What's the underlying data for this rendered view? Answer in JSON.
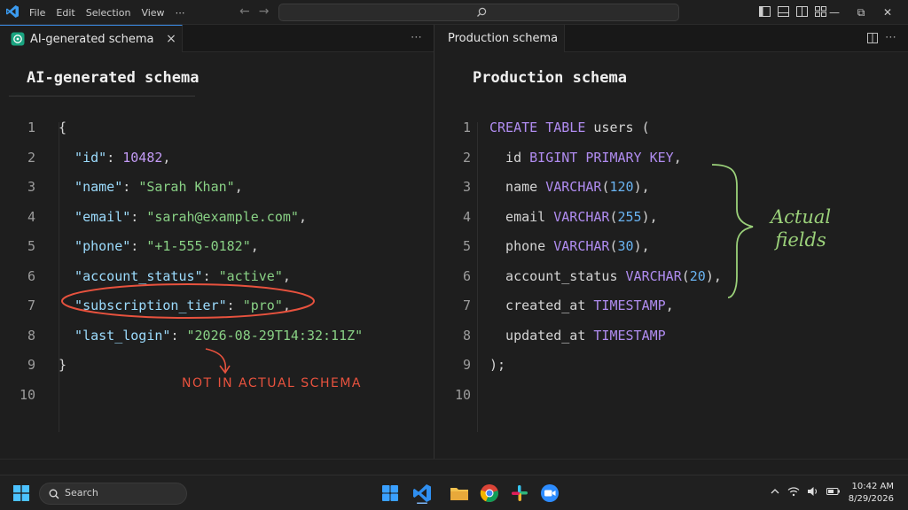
{
  "menu": [
    "File",
    "Edit",
    "Selection",
    "View",
    "⋯"
  ],
  "left": {
    "tab_label": "AI-generated schema",
    "close": "×",
    "more": "⋯",
    "heading": "AI-generated schema",
    "lines": [
      {
        "num": "1",
        "parts": [
          [
            "p",
            "{"
          ]
        ]
      },
      {
        "num": "2",
        "parts": [
          [
            "k",
            "  \"id\""
          ],
          [
            "p",
            ": "
          ],
          [
            "n",
            "10482"
          ],
          [
            "p",
            ","
          ]
        ]
      },
      {
        "num": "3",
        "parts": [
          [
            "k",
            "  \"name\""
          ],
          [
            "p",
            ": "
          ],
          [
            "s",
            "\"Sarah Khan\""
          ],
          [
            "p",
            ","
          ]
        ]
      },
      {
        "num": "4",
        "parts": [
          [
            "k",
            "  \"email\""
          ],
          [
            "p",
            ": "
          ],
          [
            "s",
            "\"sarah@example.com\""
          ],
          [
            "p",
            ","
          ]
        ]
      },
      {
        "num": "5",
        "parts": [
          [
            "k",
            "  \"phone\""
          ],
          [
            "p",
            ": "
          ],
          [
            "s",
            "\"+1-555-0182\""
          ],
          [
            "p",
            ","
          ]
        ]
      },
      {
        "num": "6",
        "parts": [
          [
            "k",
            "  \"account_status\""
          ],
          [
            "p",
            ": "
          ],
          [
            "s",
            "\"active\""
          ],
          [
            "p",
            ","
          ]
        ]
      },
      {
        "num": "7",
        "parts": [
          [
            "k",
            "  \"subscription_tier\""
          ],
          [
            "p",
            ": "
          ],
          [
            "s",
            "\"pro\""
          ],
          [
            "p",
            ","
          ]
        ]
      },
      {
        "num": "8",
        "parts": [
          [
            "k",
            "  \"last_login\""
          ],
          [
            "p",
            ": "
          ],
          [
            "s",
            "\"2026-08-29T14:32:11Z\""
          ]
        ]
      },
      {
        "num": "9",
        "parts": [
          [
            "p",
            "}"
          ]
        ]
      },
      {
        "num": "10",
        "parts": []
      }
    ],
    "annotation": "NOT IN ACTUAL SCHEMA"
  },
  "right": {
    "tab_label": "Production schema",
    "heading": "Production schema",
    "lines": [
      {
        "num": "1",
        "parts": [
          [
            "kw",
            "CREATE TABLE"
          ],
          [
            "p",
            " users ("
          ]
        ]
      },
      {
        "num": "2",
        "parts": [
          [
            "p",
            "  id "
          ],
          [
            "kw",
            "BIGINT PRIMARY KEY"
          ],
          [
            "p",
            ","
          ]
        ]
      },
      {
        "num": "3",
        "parts": [
          [
            "p",
            "  name "
          ],
          [
            "kw",
            "VARCHAR"
          ],
          [
            "p",
            "("
          ],
          [
            "num",
            "120"
          ],
          [
            "p",
            "),"
          ]
        ]
      },
      {
        "num": "4",
        "parts": [
          [
            "p",
            "  email "
          ],
          [
            "kw",
            "VARCHAR"
          ],
          [
            "p",
            "("
          ],
          [
            "num",
            "255"
          ],
          [
            "p",
            "),"
          ]
        ]
      },
      {
        "num": "5",
        "parts": [
          [
            "p",
            "  phone "
          ],
          [
            "kw",
            "VARCHAR"
          ],
          [
            "p",
            "("
          ],
          [
            "num",
            "30"
          ],
          [
            "p",
            "),"
          ]
        ]
      },
      {
        "num": "6",
        "parts": [
          [
            "p",
            "  account_status "
          ],
          [
            "kw",
            "VARCHAR"
          ],
          [
            "p",
            "("
          ],
          [
            "num",
            "20"
          ],
          [
            "p",
            "),"
          ]
        ]
      },
      {
        "num": "7",
        "parts": [
          [
            "p",
            "  created_at "
          ],
          [
            "kw",
            "TIMESTAMP"
          ],
          [
            "p",
            ","
          ]
        ]
      },
      {
        "num": "8",
        "parts": [
          [
            "p",
            "  updated_at "
          ],
          [
            "kw",
            "TIMESTAMP"
          ]
        ]
      },
      {
        "num": "9",
        "parts": [
          [
            "p",
            ");"
          ]
        ]
      },
      {
        "num": "10",
        "parts": []
      }
    ],
    "annotation_line1": "Actual",
    "annotation_line2": "fields"
  },
  "taskbar": {
    "search_label": "Search",
    "time": "10:42 AM",
    "date": "8/29/2026"
  },
  "colors": {
    "accent": "#3b8eea",
    "annotation_red": "#e8523e",
    "annotation_green": "#9bd17a"
  }
}
